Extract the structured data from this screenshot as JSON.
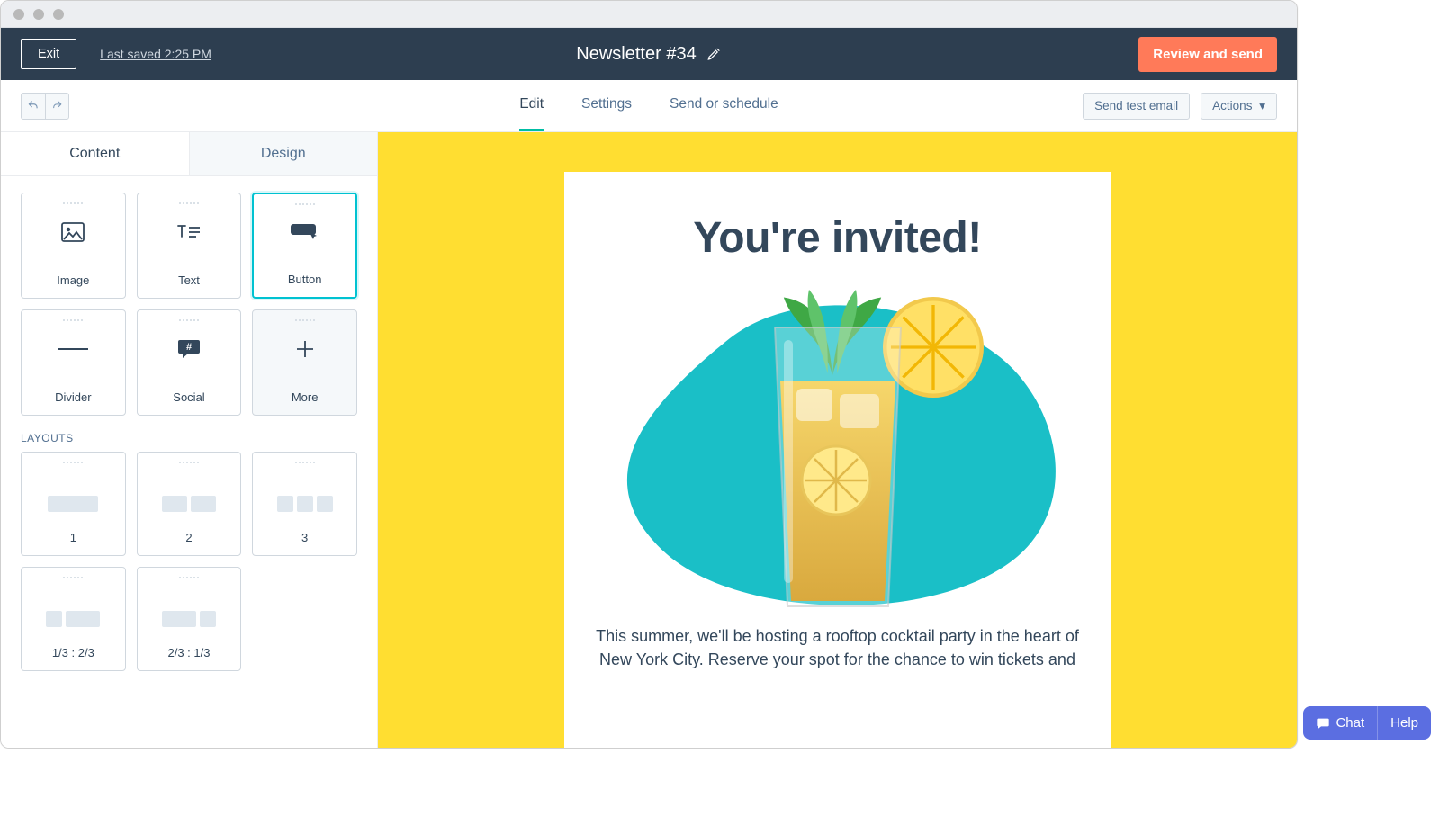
{
  "header": {
    "exit_label": "Exit",
    "last_saved": "Last saved 2:25 PM",
    "document_title": "Newsletter #34",
    "review_send_label": "Review and send"
  },
  "tabbar": {
    "tabs": [
      {
        "label": "Edit",
        "active": true
      },
      {
        "label": "Settings",
        "active": false
      },
      {
        "label": "Send or schedule",
        "active": false
      }
    ],
    "send_test_label": "Send test email",
    "actions_label": "Actions"
  },
  "sidebar": {
    "tabs": {
      "content": "Content",
      "design": "Design"
    },
    "blocks": [
      {
        "label": "Image",
        "icon": "image"
      },
      {
        "label": "Text",
        "icon": "text"
      },
      {
        "label": "Button",
        "icon": "button",
        "selected": true
      },
      {
        "label": "Divider",
        "icon": "divider"
      },
      {
        "label": "Social",
        "icon": "social"
      },
      {
        "label": "More",
        "icon": "plus",
        "dim": true
      }
    ],
    "layouts_label": "LAYOUTS",
    "layouts": [
      {
        "label": "1",
        "cols": [
          56
        ]
      },
      {
        "label": "2",
        "cols": [
          28,
          28
        ]
      },
      {
        "label": "3",
        "cols": [
          18,
          18,
          18
        ]
      },
      {
        "label": "1/3 : 2/3",
        "cols": [
          18,
          38
        ]
      },
      {
        "label": "2/3 : 1/3",
        "cols": [
          38,
          18
        ]
      }
    ]
  },
  "email": {
    "title": "You're invited!",
    "body": "This summer, we'll be hosting a rooftop cocktail party in the heart of New York City. Reserve your spot for the chance to win tickets and",
    "hero_image_alt": "Glass of iced lemonade with mint and lemon slices on teal blob background"
  },
  "help": {
    "chat": "Chat",
    "help": "Help"
  }
}
